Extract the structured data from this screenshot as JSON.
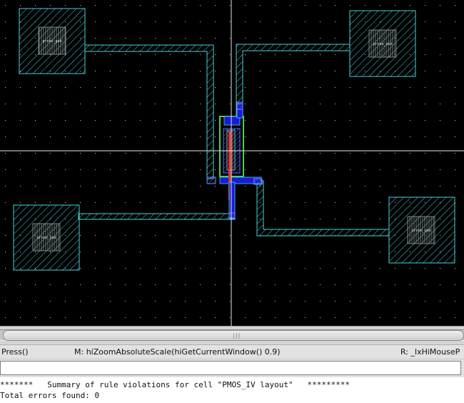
{
  "layout": {
    "background": "#000000",
    "grid_color": "#d0d0d0",
    "colors": {
      "metal1": "#49d2d8",
      "poly": "#d83434",
      "diffusion": "#49d24f",
      "contact": "#1a1ad8",
      "select": "#7a8cff",
      "crosshair": "#e6e6e6"
    },
    "pins": [
      {
        "name": "probe_pad"
      },
      {
        "name": "probe_pad"
      },
      {
        "name": "probe_pad"
      },
      {
        "name": "probe_pad"
      }
    ]
  },
  "status_bar": {
    "left": "Press()",
    "middle": "M: hiZoomAbsoluteScale(hiGetCurrentWindow() 0.9)",
    "right": "R: _lxHiMouseP"
  },
  "command": {
    "value": ""
  },
  "log": {
    "line1": "*******   Summary of rule violations for cell \"PMOS_IV layout\"   *********",
    "line2": "Total errors found: 0"
  }
}
